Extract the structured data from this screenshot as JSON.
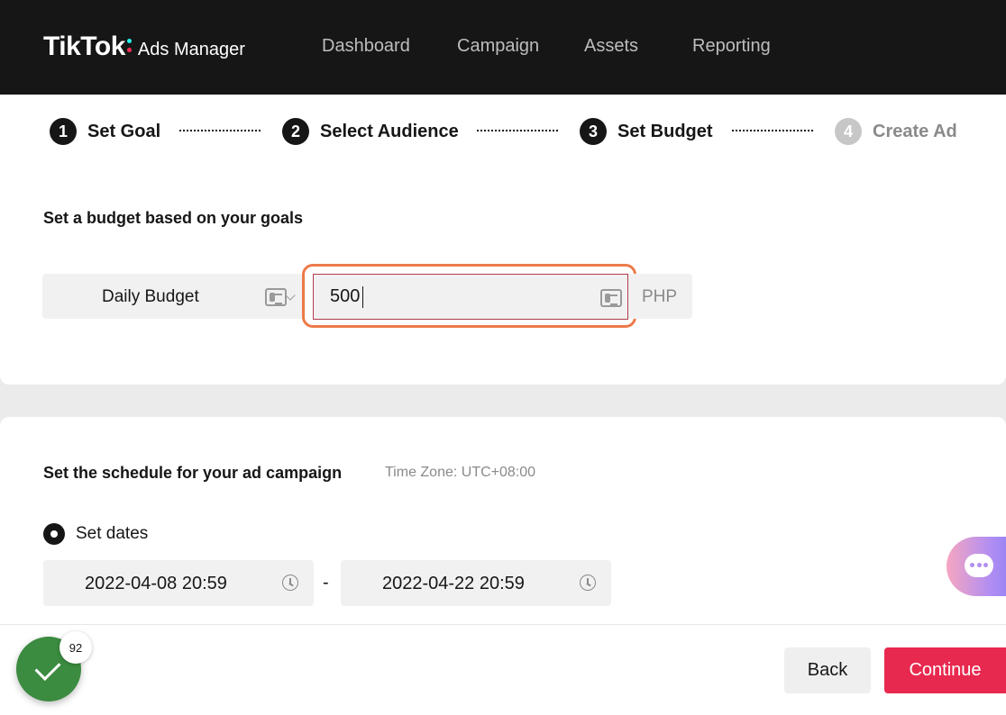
{
  "header": {
    "logo_main": "TikTok",
    "logo_sub": "Ads Manager",
    "nav": [
      "Dashboard",
      "Campaign",
      "Assets",
      "Reporting"
    ]
  },
  "steps": [
    {
      "num": "1",
      "label": "Set Goal",
      "active": true
    },
    {
      "num": "2",
      "label": "Select Audience",
      "active": true
    },
    {
      "num": "3",
      "label": "Set Budget",
      "active": true
    },
    {
      "num": "4",
      "label": "Create Ad",
      "active": false
    }
  ],
  "budget": {
    "title": "Set a budget based on your goals",
    "type_selected": "Daily Budget",
    "amount": "500",
    "currency": "PHP"
  },
  "schedule": {
    "title": "Set the schedule for your ad campaign",
    "timezone": "Time Zone: UTC+08:00",
    "option_label": "Set dates",
    "start": "2022-04-08 20:59",
    "separator": "-",
    "end": "2022-04-22 20:59"
  },
  "footer": {
    "back_label": "Back",
    "continue_label": "Continue"
  },
  "widget": {
    "badge_count": "92"
  },
  "colors": {
    "brand_red": "#e8294f",
    "highlight_orange": "#ec7a4a",
    "success_green": "#3b8b40"
  }
}
